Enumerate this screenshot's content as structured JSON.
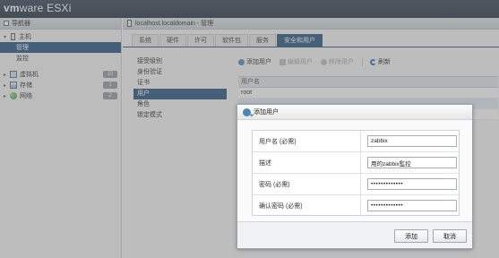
{
  "header": {
    "brand_vm": "vm",
    "brand_ware": "ware",
    "brand_esxi": "ESXi"
  },
  "navigator": {
    "title": "导航器",
    "host_label": "主机",
    "host_children": [
      {
        "label": "管理",
        "selected": true
      },
      {
        "label": "监控",
        "selected": false
      }
    ],
    "items": [
      {
        "label": "虚拟机",
        "count": "10",
        "icon": "vm-icon"
      },
      {
        "label": "存储",
        "count": "1",
        "icon": "storage-icon"
      },
      {
        "label": "网络",
        "count": "2",
        "icon": "network-icon"
      }
    ]
  },
  "main": {
    "breadcrumb": "localhost.localdomain - 管理",
    "tabs": [
      "系统",
      "硬件",
      "许可",
      "软件包",
      "服务",
      "安全和用户"
    ],
    "active_tab": 5,
    "submenu": [
      {
        "label": "接受级别",
        "selected": false
      },
      {
        "label": "身份验证",
        "selected": false
      },
      {
        "label": "证书",
        "selected": false
      },
      {
        "label": "用户",
        "selected": true
      },
      {
        "label": "角色",
        "selected": false
      },
      {
        "label": "锁定模式",
        "selected": false
      }
    ],
    "toolbar": {
      "add_user": "添加用户",
      "edit_user": "编辑用户",
      "remove_user": "移除用户",
      "refresh": "刷新"
    },
    "grid": {
      "header": "用户名",
      "rows": [
        "root",
        "",
        ""
      ]
    }
  },
  "dialog": {
    "title": "添加用户",
    "fields": [
      {
        "label": "用户名 (必需)",
        "value": "zabbix"
      },
      {
        "label": "描述",
        "value": "用的zabbix監控"
      },
      {
        "label": "密码 (必需)",
        "value": "•••••••••••••"
      },
      {
        "label": "确认密码 (必需)",
        "value": "•••••••••••••"
      }
    ],
    "ok_label": "添加",
    "cancel_label": "取消"
  },
  "colors": {
    "header_bg": "#1d2a38",
    "selected_bg": "#1e4b7a",
    "tab_active_bg": "#1f4e79"
  }
}
